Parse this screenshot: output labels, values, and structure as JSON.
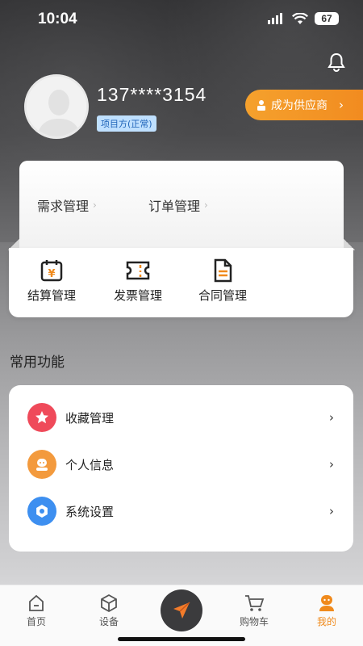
{
  "status_bar": {
    "time": "10:04",
    "battery": "67"
  },
  "profile": {
    "phone": "137****3154",
    "role_badge": "项目方(正常)",
    "supplier_button": "成为供应商"
  },
  "management": [
    {
      "label": "需求管理"
    },
    {
      "label": "订单管理"
    }
  ],
  "finance": [
    {
      "label": "结算管理",
      "icon": "yen-calendar-icon"
    },
    {
      "label": "发票管理",
      "icon": "ticket-icon"
    },
    {
      "label": "合同管理",
      "icon": "document-icon"
    }
  ],
  "common_functions": {
    "title": "常用功能",
    "items": [
      {
        "label": "收藏管理",
        "icon": "star-icon",
        "color": "#ef4a5a"
      },
      {
        "label": "个人信息",
        "icon": "person-icon",
        "color": "#f39a3d"
      },
      {
        "label": "系统设置",
        "icon": "gear-icon",
        "color": "#3d8ff0"
      }
    ]
  },
  "tabbar": [
    {
      "label": "首页",
      "icon": "home-icon"
    },
    {
      "label": "设备",
      "icon": "cube-icon"
    },
    {
      "label": "购物车",
      "icon": "cart-icon"
    },
    {
      "label": "我的",
      "icon": "profile-icon",
      "active": true
    }
  ],
  "colors": {
    "accent": "#f08a1c",
    "badge_text": "#1e63b8"
  }
}
